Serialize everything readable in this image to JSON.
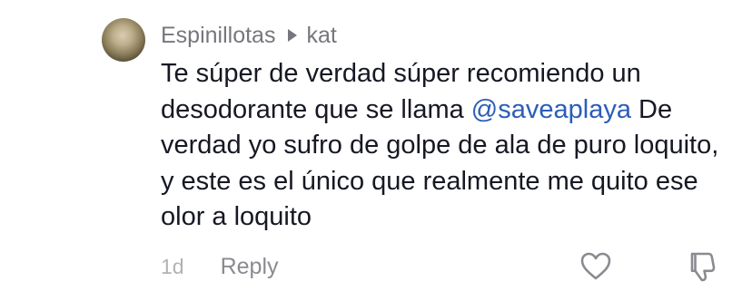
{
  "comment": {
    "author": "Espinillotas",
    "reply_to": "kat",
    "text_before_mention": "Te súper de verdad súper recomiendo un desodorante que se llama ",
    "mention": "@saveaplaya",
    "text_after_mention": " De verdad yo sufro de golpe de ala de puro loquito, y este es el único que realmente me quito ese olor a loquito",
    "timestamp": "1d",
    "reply_label": "Reply",
    "icons": {
      "avatar": "avatar",
      "reply_to": "caret-right-icon",
      "like": "heart-icon",
      "dislike": "thumbs-down-icon"
    },
    "colors": {
      "text": "#161823",
      "muted": "#76777d",
      "mention": "#2b5db8",
      "timestamp": "#b1b2b6"
    }
  }
}
